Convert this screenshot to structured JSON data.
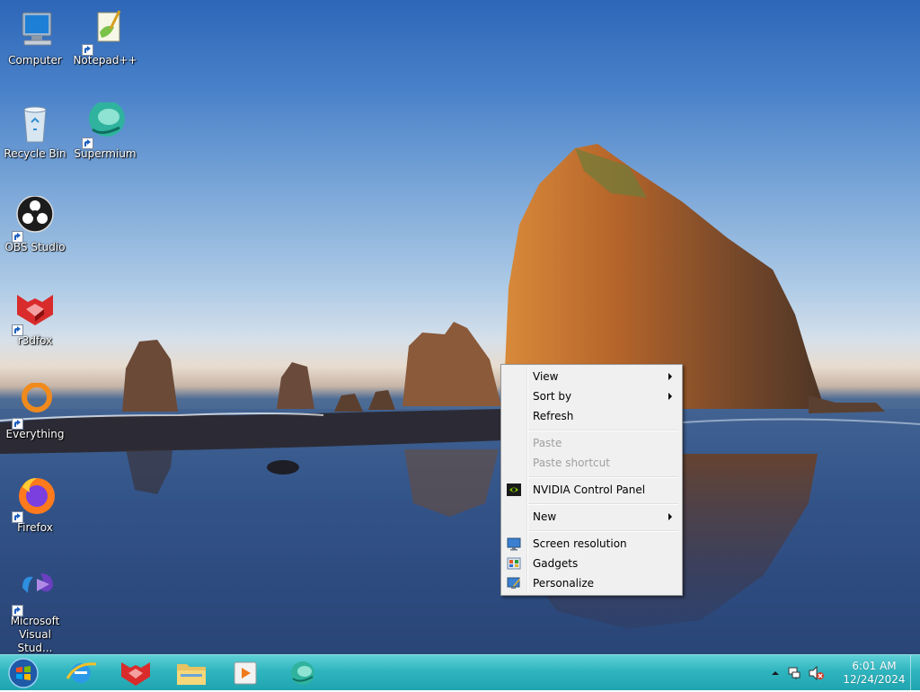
{
  "desktop_icons": [
    {
      "label": "Computer",
      "icon": "computer-icon"
    },
    {
      "label": "Notepad++",
      "icon": "notepadpp-icon"
    },
    {
      "label": "Recycle Bin",
      "icon": "recycle-bin-icon"
    },
    {
      "label": "Supermium",
      "icon": "supermium-icon"
    },
    {
      "label": "OBS Studio",
      "icon": "obs-icon"
    },
    {
      "label": "r3dfox",
      "icon": "r3dfox-icon"
    },
    {
      "label": "Everything",
      "icon": "everything-icon"
    },
    {
      "label": "Firefox",
      "icon": "firefox-icon"
    },
    {
      "label": "Microsoft Visual Stud...",
      "icon": "visual-studio-icon"
    }
  ],
  "context_menu": {
    "view": "View",
    "sort_by": "Sort by",
    "refresh": "Refresh",
    "paste": "Paste",
    "paste_shortcut": "Paste shortcut",
    "nvidia": "NVIDIA Control Panel",
    "new": "New",
    "screen_resolution": "Screen resolution",
    "gadgets": "Gadgets",
    "personalize": "Personalize"
  },
  "taskbar": {
    "pinned": [
      "internet-explorer-icon",
      "r3dfox-icon",
      "file-explorer-icon",
      "media-player-icon",
      "supermium-icon"
    ]
  },
  "clock": {
    "time": "6:01 AM",
    "date": "12/24/2024"
  },
  "colors": {
    "taskbar": "#2fb5bf",
    "menu_bg": "#f0f0f0"
  }
}
